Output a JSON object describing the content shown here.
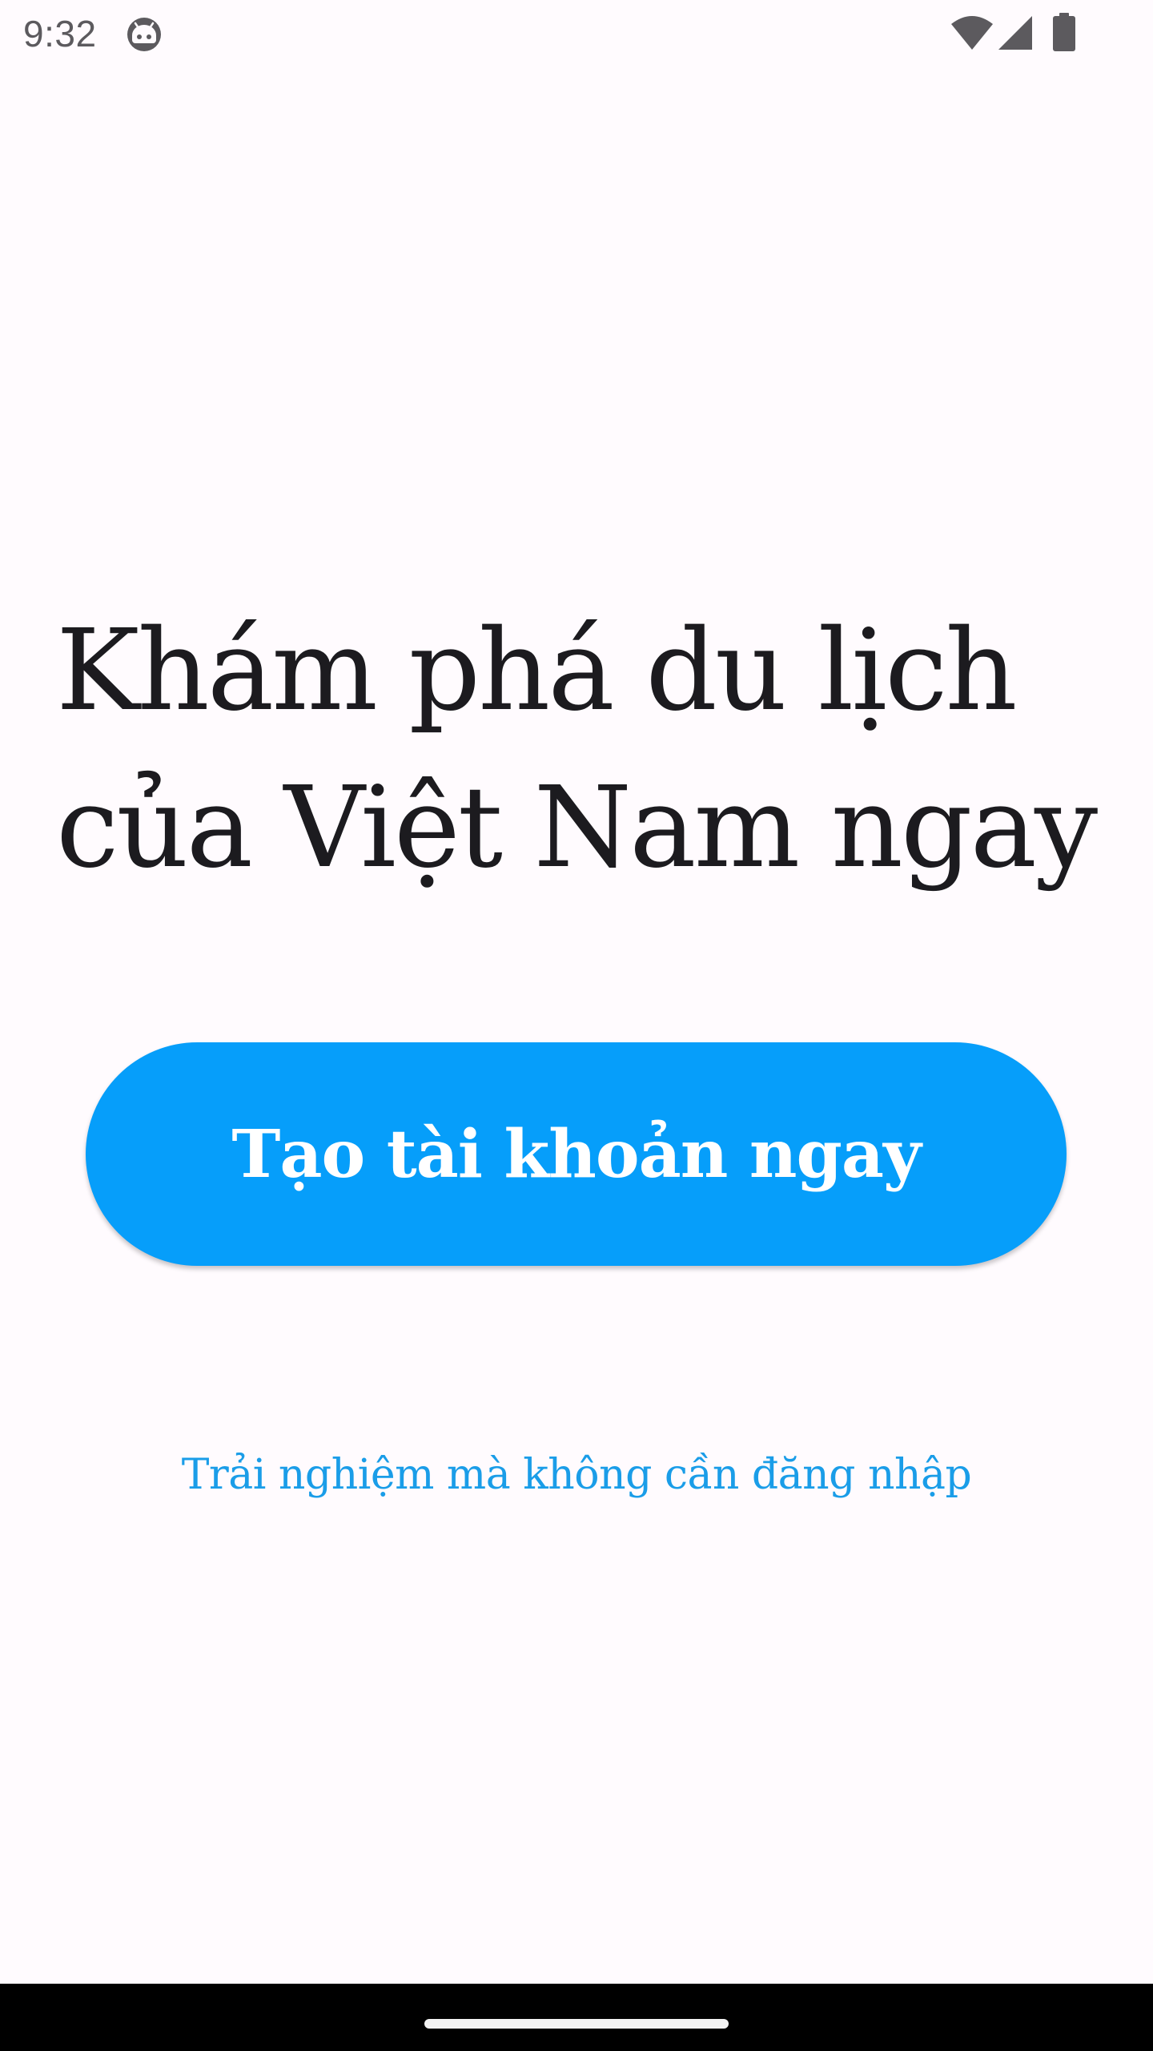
{
  "status_bar": {
    "time": "9:32",
    "app_icon": "android-face-icon",
    "wifi_icon": "wifi-icon",
    "signal_icon": "cell-signal-icon",
    "battery_icon": "battery-icon",
    "icon_color": "#5c5a5e"
  },
  "main": {
    "headline": "Khám phá du lịch của Việt Nam ngay",
    "create_account_label": "Tạo tài khoản ngay",
    "skip_login_label": "Trải nghiệm mà không cần đăng nhập"
  },
  "colors": {
    "background": "#fffbfe",
    "primary": "#069efa",
    "link": "#1a9de8",
    "text": "#1c1b1f",
    "nav_bar": "#000000"
  },
  "nav_bar": {
    "home_indicator": "home-gesture-bar"
  }
}
